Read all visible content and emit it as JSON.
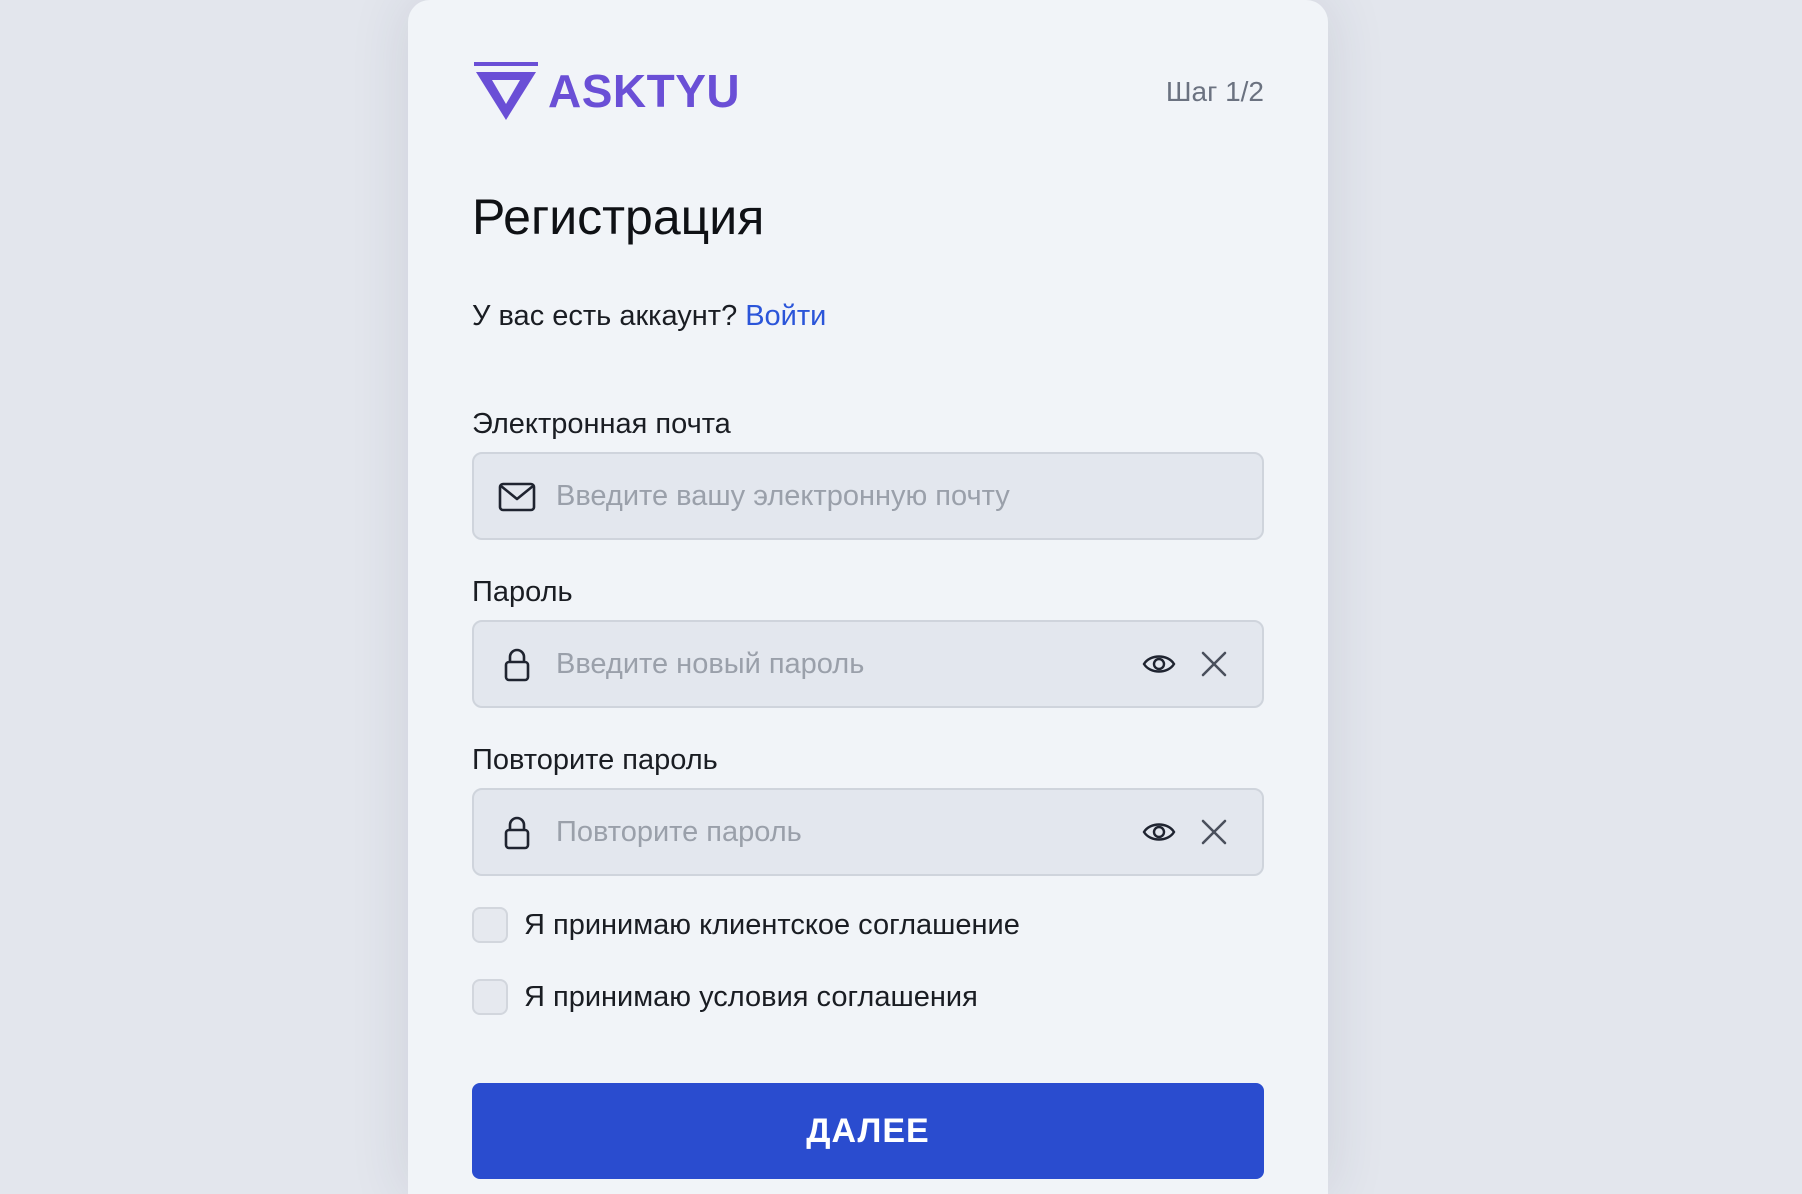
{
  "brand": {
    "name": "ASKTYU",
    "logo_icon": "v-triangle-logo-icon",
    "color": "#6a4fd6"
  },
  "step": "Шаг 1/2",
  "title": "Регистрация",
  "login_prompt": {
    "text": "У вас есть аккаунт?",
    "link": "Войти",
    "link_color": "#2b55d9"
  },
  "fields": {
    "email": {
      "label": "Электронная почта",
      "placeholder": "Введите вашу электронную почту",
      "icon": "mail-icon"
    },
    "password": {
      "label": "Пароль",
      "placeholder": "Введите новый пароль",
      "icon": "lock-icon"
    },
    "repeat_password": {
      "label": "Повторите пароль",
      "placeholder": "Повторите пароль",
      "icon": "lock-icon"
    }
  },
  "checkboxes": [
    {
      "label": "Я принимаю клиентское соглашение",
      "checked": false
    },
    {
      "label": "Я принимаю условия соглашения",
      "checked": false
    }
  ],
  "submit": {
    "label": "ДАЛЕЕ",
    "color": "#2a4ccf"
  }
}
